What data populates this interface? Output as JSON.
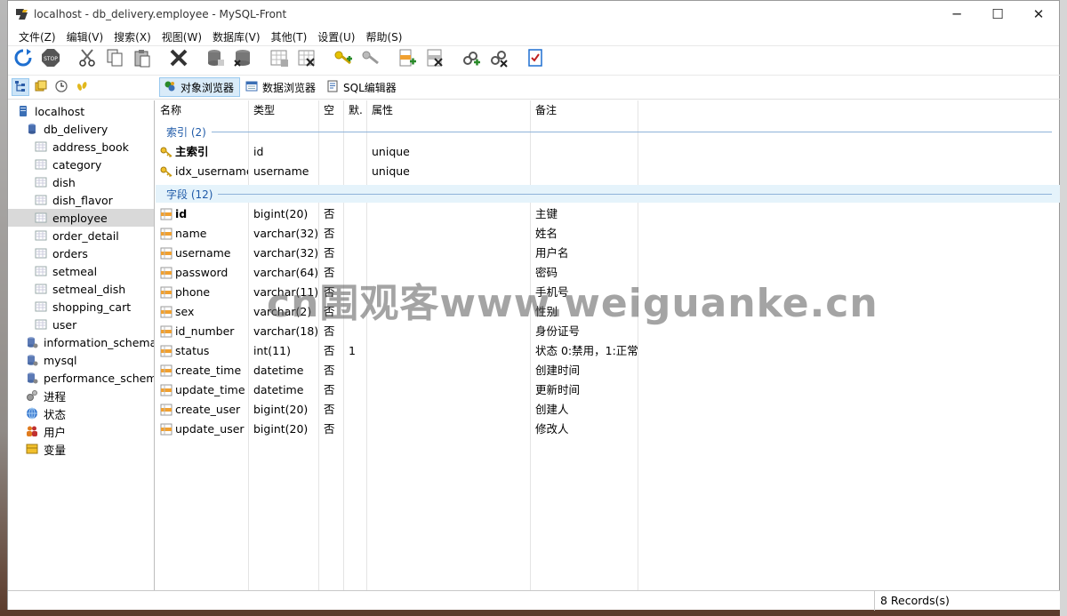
{
  "window": {
    "title": "localhost - db_delivery.employee - MySQL-Front",
    "min": "─",
    "max": "☐",
    "close": "✕"
  },
  "menu": [
    "文件(Z)",
    "编辑(V)",
    "搜索(X)",
    "视图(W)",
    "数据库(V)",
    "其他(T)",
    "设置(U)",
    "帮助(S)"
  ],
  "toolbar_icons": [
    "refresh-icon",
    "stop-icon",
    "cut-icon",
    "copy-icon",
    "paste-icon",
    "delete-icon",
    "create-database-icon",
    "drop-database-icon",
    "create-table-icon",
    "drop-table-icon",
    "create-index-icon",
    "drop-index-icon",
    "create-field-icon",
    "drop-field-icon",
    "create-foreign-key-icon",
    "drop-foreign-key-icon",
    "properties-icon"
  ],
  "side_toolbar_icons": [
    "tree-view-icon",
    "favorites-icon",
    "history-icon",
    "footprints-icon"
  ],
  "tabs": [
    {
      "label": "对象浏览器",
      "icon": "object-browser-icon",
      "active": true
    },
    {
      "label": "数据浏览器",
      "icon": "data-browser-icon",
      "active": false
    },
    {
      "label": "SQL编辑器",
      "icon": "sql-editor-icon",
      "active": false
    }
  ],
  "tree": [
    {
      "label": "localhost",
      "level": 0,
      "icon": "server-icon"
    },
    {
      "label": "db_delivery",
      "level": 1,
      "icon": "database-icon"
    },
    {
      "label": "address_book",
      "level": 2,
      "icon": "table-icon"
    },
    {
      "label": "category",
      "level": 2,
      "icon": "table-icon"
    },
    {
      "label": "dish",
      "level": 2,
      "icon": "table-icon"
    },
    {
      "label": "dish_flavor",
      "level": 2,
      "icon": "table-icon"
    },
    {
      "label": "employee",
      "level": 2,
      "icon": "table-icon",
      "selected": true
    },
    {
      "label": "order_detail",
      "level": 2,
      "icon": "table-icon"
    },
    {
      "label": "orders",
      "level": 2,
      "icon": "table-icon"
    },
    {
      "label": "setmeal",
      "level": 2,
      "icon": "table-icon"
    },
    {
      "label": "setmeal_dish",
      "level": 2,
      "icon": "table-icon"
    },
    {
      "label": "shopping_cart",
      "level": 2,
      "icon": "table-icon"
    },
    {
      "label": "user",
      "level": 2,
      "icon": "table-icon"
    },
    {
      "label": "information_schema",
      "level": 1,
      "icon": "system-database-icon"
    },
    {
      "label": "mysql",
      "level": 1,
      "icon": "system-database-icon"
    },
    {
      "label": "performance_schema",
      "level": 1,
      "icon": "system-database-icon"
    },
    {
      "label": "进程",
      "level": 1,
      "icon": "processes-icon"
    },
    {
      "label": "状态",
      "level": 1,
      "icon": "status-icon"
    },
    {
      "label": "用户",
      "level": 1,
      "icon": "users-icon"
    },
    {
      "label": "变量",
      "level": 1,
      "icon": "variables-icon"
    }
  ],
  "columns": [
    "名称",
    "类型",
    "空",
    "默.",
    "属性",
    "备注"
  ],
  "index_group": "索引 (2)",
  "indexes": [
    {
      "name": "主索引",
      "type": "id",
      "null": "",
      "default": "",
      "attr": "unique",
      "comment": "",
      "bold": true
    },
    {
      "name": "idx_username",
      "type": "username",
      "null": "",
      "default": "",
      "attr": "unique",
      "comment": "",
      "bold": false
    }
  ],
  "field_group": "字段 (12)",
  "fields": [
    {
      "name": "id",
      "type": "bigint(20)",
      "null": "否",
      "default": "",
      "attr": "",
      "comment": "主键",
      "bold": true
    },
    {
      "name": "name",
      "type": "varchar(32)",
      "null": "否",
      "default": "",
      "attr": "",
      "comment": "姓名",
      "bold": false
    },
    {
      "name": "username",
      "type": "varchar(32)",
      "null": "否",
      "default": "",
      "attr": "",
      "comment": "用户名",
      "bold": false
    },
    {
      "name": "password",
      "type": "varchar(64)",
      "null": "否",
      "default": "",
      "attr": "",
      "comment": "密码",
      "bold": false
    },
    {
      "name": "phone",
      "type": "varchar(11)",
      "null": "否",
      "default": "",
      "attr": "",
      "comment": "手机号",
      "bold": false
    },
    {
      "name": "sex",
      "type": "varchar(2)",
      "null": "否",
      "default": "",
      "attr": "",
      "comment": "性别",
      "bold": false
    },
    {
      "name": "id_number",
      "type": "varchar(18)",
      "null": "否",
      "default": "",
      "attr": "",
      "comment": "身份证号",
      "bold": false
    },
    {
      "name": "status",
      "type": "int(11)",
      "null": "否",
      "default": "1",
      "attr": "",
      "comment": "状态 0:禁用，1:正常",
      "bold": false
    },
    {
      "name": "create_time",
      "type": "datetime",
      "null": "否",
      "default": "",
      "attr": "",
      "comment": "创建时间",
      "bold": false
    },
    {
      "name": "update_time",
      "type": "datetime",
      "null": "否",
      "default": "",
      "attr": "",
      "comment": "更新时间",
      "bold": false
    },
    {
      "name": "create_user",
      "type": "bigint(20)",
      "null": "否",
      "default": "",
      "attr": "",
      "comment": "创建人",
      "bold": false
    },
    {
      "name": "update_user",
      "type": "bigint(20)",
      "null": "否",
      "default": "",
      "attr": "",
      "comment": "修改人",
      "bold": false
    }
  ],
  "status": {
    "records": "8 Records(s)"
  },
  "watermark": "cn围观客www.weiguanke.cn"
}
